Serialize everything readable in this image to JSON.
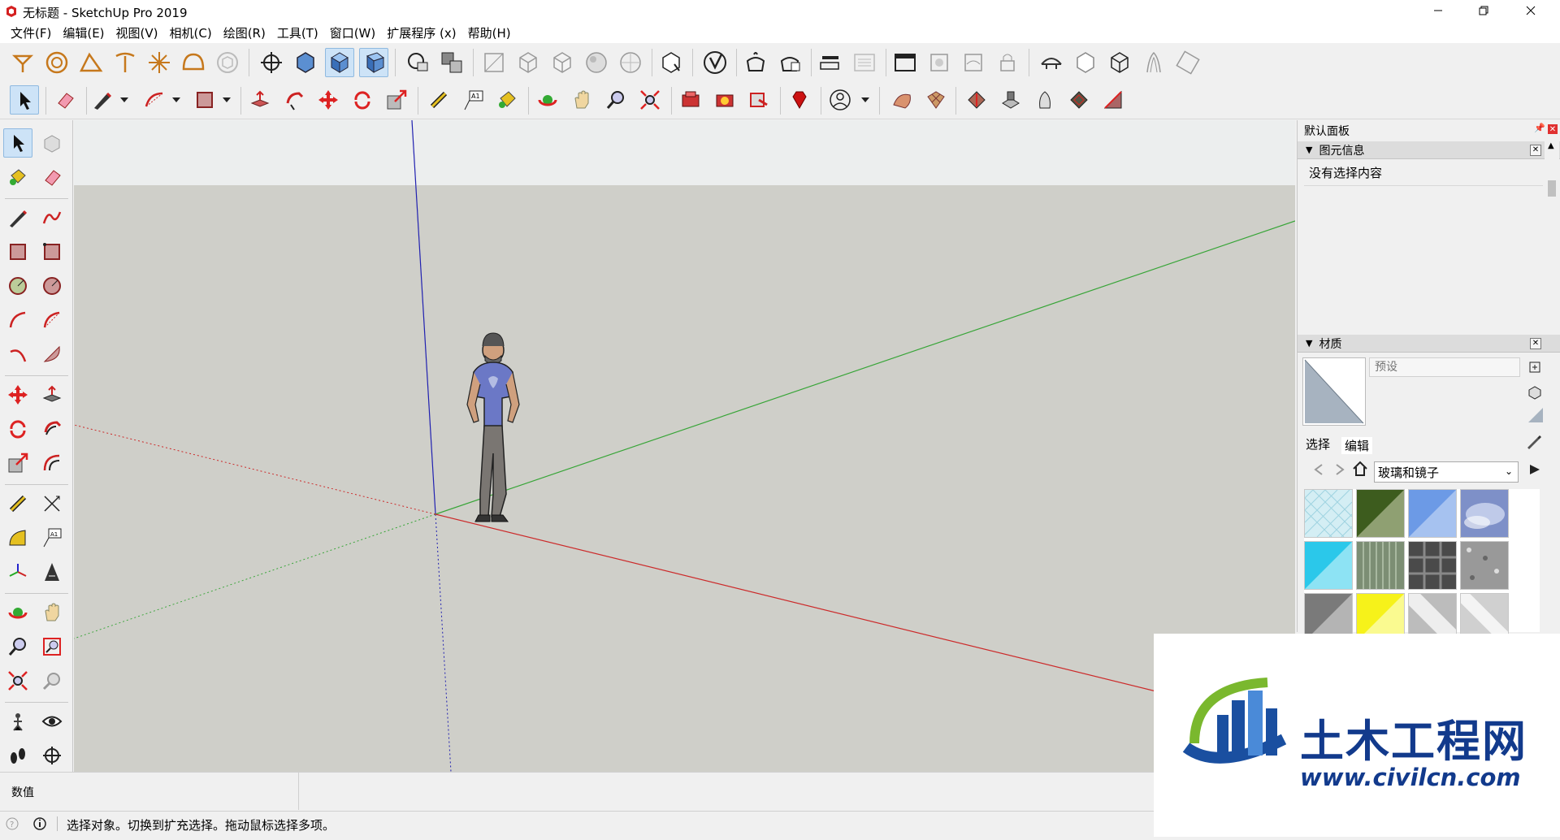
{
  "window": {
    "title": "无标题 - SketchUp Pro 2019",
    "icon": "sketchup-logo-icon",
    "controls": [
      "minimize-icon",
      "maximize-icon",
      "close-icon"
    ]
  },
  "menubar": {
    "items": [
      "文件(F)",
      "编辑(E)",
      "视图(V)",
      "相机(C)",
      "绘图(R)",
      "工具(T)",
      "窗口(W)",
      "扩展程序 (x)",
      "帮助(H)"
    ]
  },
  "toolbar_top": {
    "icons": [
      "large-toolset-icon",
      "circle-icon",
      "protractor-icon",
      "tape-icon",
      "axes-star-icon",
      "dome-icon",
      "iso-box-icon",
      "orbit-target-icon",
      "std-view-top-icon",
      "std-view-iso-icon",
      "std-view-front-icon",
      "section-plane-icon",
      "section-fill-icon",
      "xray-icon",
      "wireframe-icon",
      "hidden-line-icon",
      "shaded-icon",
      "textured-icon",
      "monochrome-icon",
      "component-icon",
      "solid-tools-icon",
      "warehouse-icon",
      "extension-icon",
      "share-icon",
      "layer-icon",
      "scene-icon",
      "shadow-icon",
      "fog-icon",
      "sandbox-icon",
      "terrain-icon",
      "stamp-icon",
      "drape-icon",
      "add-detail-icon",
      "flip-edge-icon",
      "smoove-icon"
    ]
  },
  "toolbar_main": {
    "icons": [
      "select-arrow-icon",
      "eraser-icon",
      "pencil-icon",
      "arc-icon",
      "rectangle-icon",
      "push-pull-icon",
      "follow-me-icon",
      "move-icon",
      "rotate-icon",
      "scale-icon",
      "tape-measure-icon",
      "text-icon",
      "paint-bucket-icon",
      "orbit-icon",
      "pan-hand-icon",
      "zoom-icon",
      "zoom-extents-icon",
      "3d-warehouse-icon",
      "extension-warehouse-icon",
      "layout-icon",
      "ruby-icon",
      "user-account-icon",
      "sandbox-from-contours-icon",
      "sandbox-from-scratch-icon",
      "smoove-tool-icon",
      "stamp-tool-icon",
      "drape-tool-icon",
      "add-detail-tool-icon",
      "flip-edge-tool-icon"
    ]
  },
  "left_toolbar": {
    "icons": [
      "select-icon",
      "make-component-icon",
      "paint-bucket-icon",
      "eraser-icon",
      "line-icon",
      "freehand-icon",
      "rectangle-icon",
      "rotated-rectangle-icon",
      "circle-icon",
      "polygon-icon",
      "arc-icon",
      "two-point-arc-icon",
      "three-point-arc-icon",
      "pie-icon",
      "move-icon",
      "push-pull-icon",
      "rotate-icon",
      "follow-me-icon",
      "scale-icon",
      "offset-icon",
      "tape-measure-icon",
      "dimension-icon",
      "protractor-icon",
      "text-icon",
      "axes-icon",
      "3d-text-icon",
      "orbit-icon",
      "pan-icon",
      "zoom-icon",
      "zoom-window-icon",
      "zoom-extents-icon",
      "previous-view-icon",
      "position-camera-icon",
      "look-around-icon",
      "walk-icon",
      "section-plane-icon"
    ]
  },
  "default_tray": {
    "title": "默认面板",
    "entity_info": {
      "header": "图元信息",
      "content": "没有选择内容"
    },
    "materials": {
      "header": "材质",
      "name_placeholder": "预设",
      "tabs": [
        "选择",
        "编辑"
      ],
      "library": "玻璃和镜子",
      "swatch_colors": [
        "#d4eef4",
        "#3d5c1e",
        "#6c9ae6",
        "#7e90c8",
        "#2bc8ea",
        "#7c8e74",
        "#4a4a4a",
        "#8a8a8a",
        "#7a7a7a",
        "#f6f21a",
        "#bcbcbc",
        "#d0d0d0"
      ]
    }
  },
  "measurements": {
    "label": "数值",
    "value": ""
  },
  "status": {
    "message": "选择对象。切换到扩充选择。拖动鼠标选择多项。"
  },
  "watermark": {
    "brand_cn": "土木工程网",
    "url": "www.civilcn.com"
  },
  "colors": {
    "sky": "#eceeee",
    "ground": "#cfcfc9",
    "axis_red": "#cc2a2a",
    "axis_green": "#38a538",
    "axis_blue": "#2020b0",
    "highlight": "#cde3f7",
    "brand_blue": "#1a4fa0",
    "brand_green": "#7ab82e"
  }
}
